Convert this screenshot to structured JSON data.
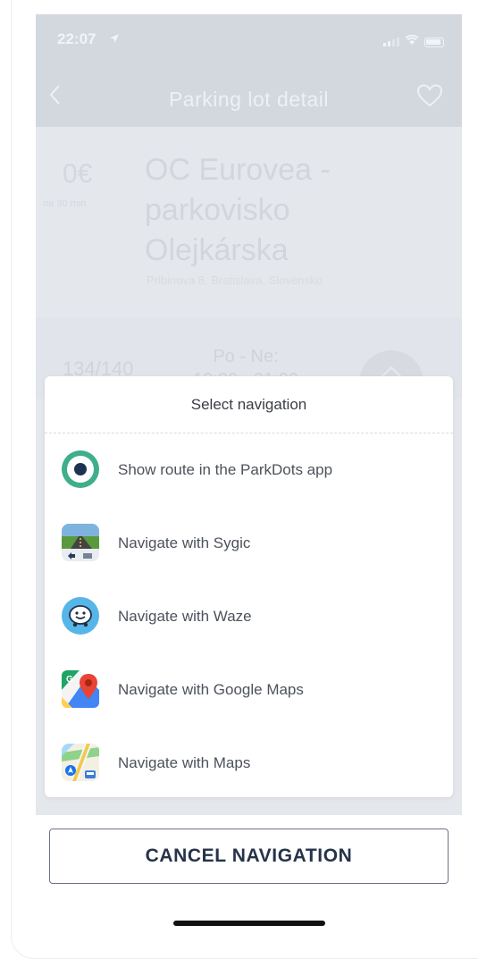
{
  "status_bar": {
    "time": "22:07",
    "location_icon": "location-arrow-icon",
    "signal_icon": "cellular-signal-icon",
    "wifi_icon": "wifi-icon",
    "battery_icon": "battery-icon"
  },
  "header": {
    "back_icon": "chevron-left-icon",
    "title": "Parking lot detail",
    "favorite_icon": "heart-outline-icon"
  },
  "parking_lot": {
    "price": "0€",
    "price_note": "na 30 min",
    "name": "OC Eurovea - parkovisko Olejkárska",
    "address": "Pribinova 8, Bratislava, Slovensko",
    "capacity": "134/140",
    "hours_days": "Po - Ne:",
    "hours_time": "10:00 - 21:00",
    "route_icon": "navigate-diamond-icon"
  },
  "navigation_sheet": {
    "title": "Select navigation",
    "options": [
      {
        "label": "Show route in the ParkDots app",
        "icon": "parkdots-icon"
      },
      {
        "label": "Navigate with Sygic",
        "icon": "sygic-icon"
      },
      {
        "label": "Navigate with Waze",
        "icon": "waze-icon"
      },
      {
        "label": "Navigate with Google Maps",
        "icon": "google-maps-icon"
      },
      {
        "label": "Navigate with Maps",
        "icon": "apple-maps-icon"
      }
    ]
  },
  "cancel_button": {
    "label": "CANCEL NAVIGATION"
  },
  "colors": {
    "accent_green": "#3fae8b",
    "navy": "#263349",
    "overlay": "#e4e7ec"
  }
}
